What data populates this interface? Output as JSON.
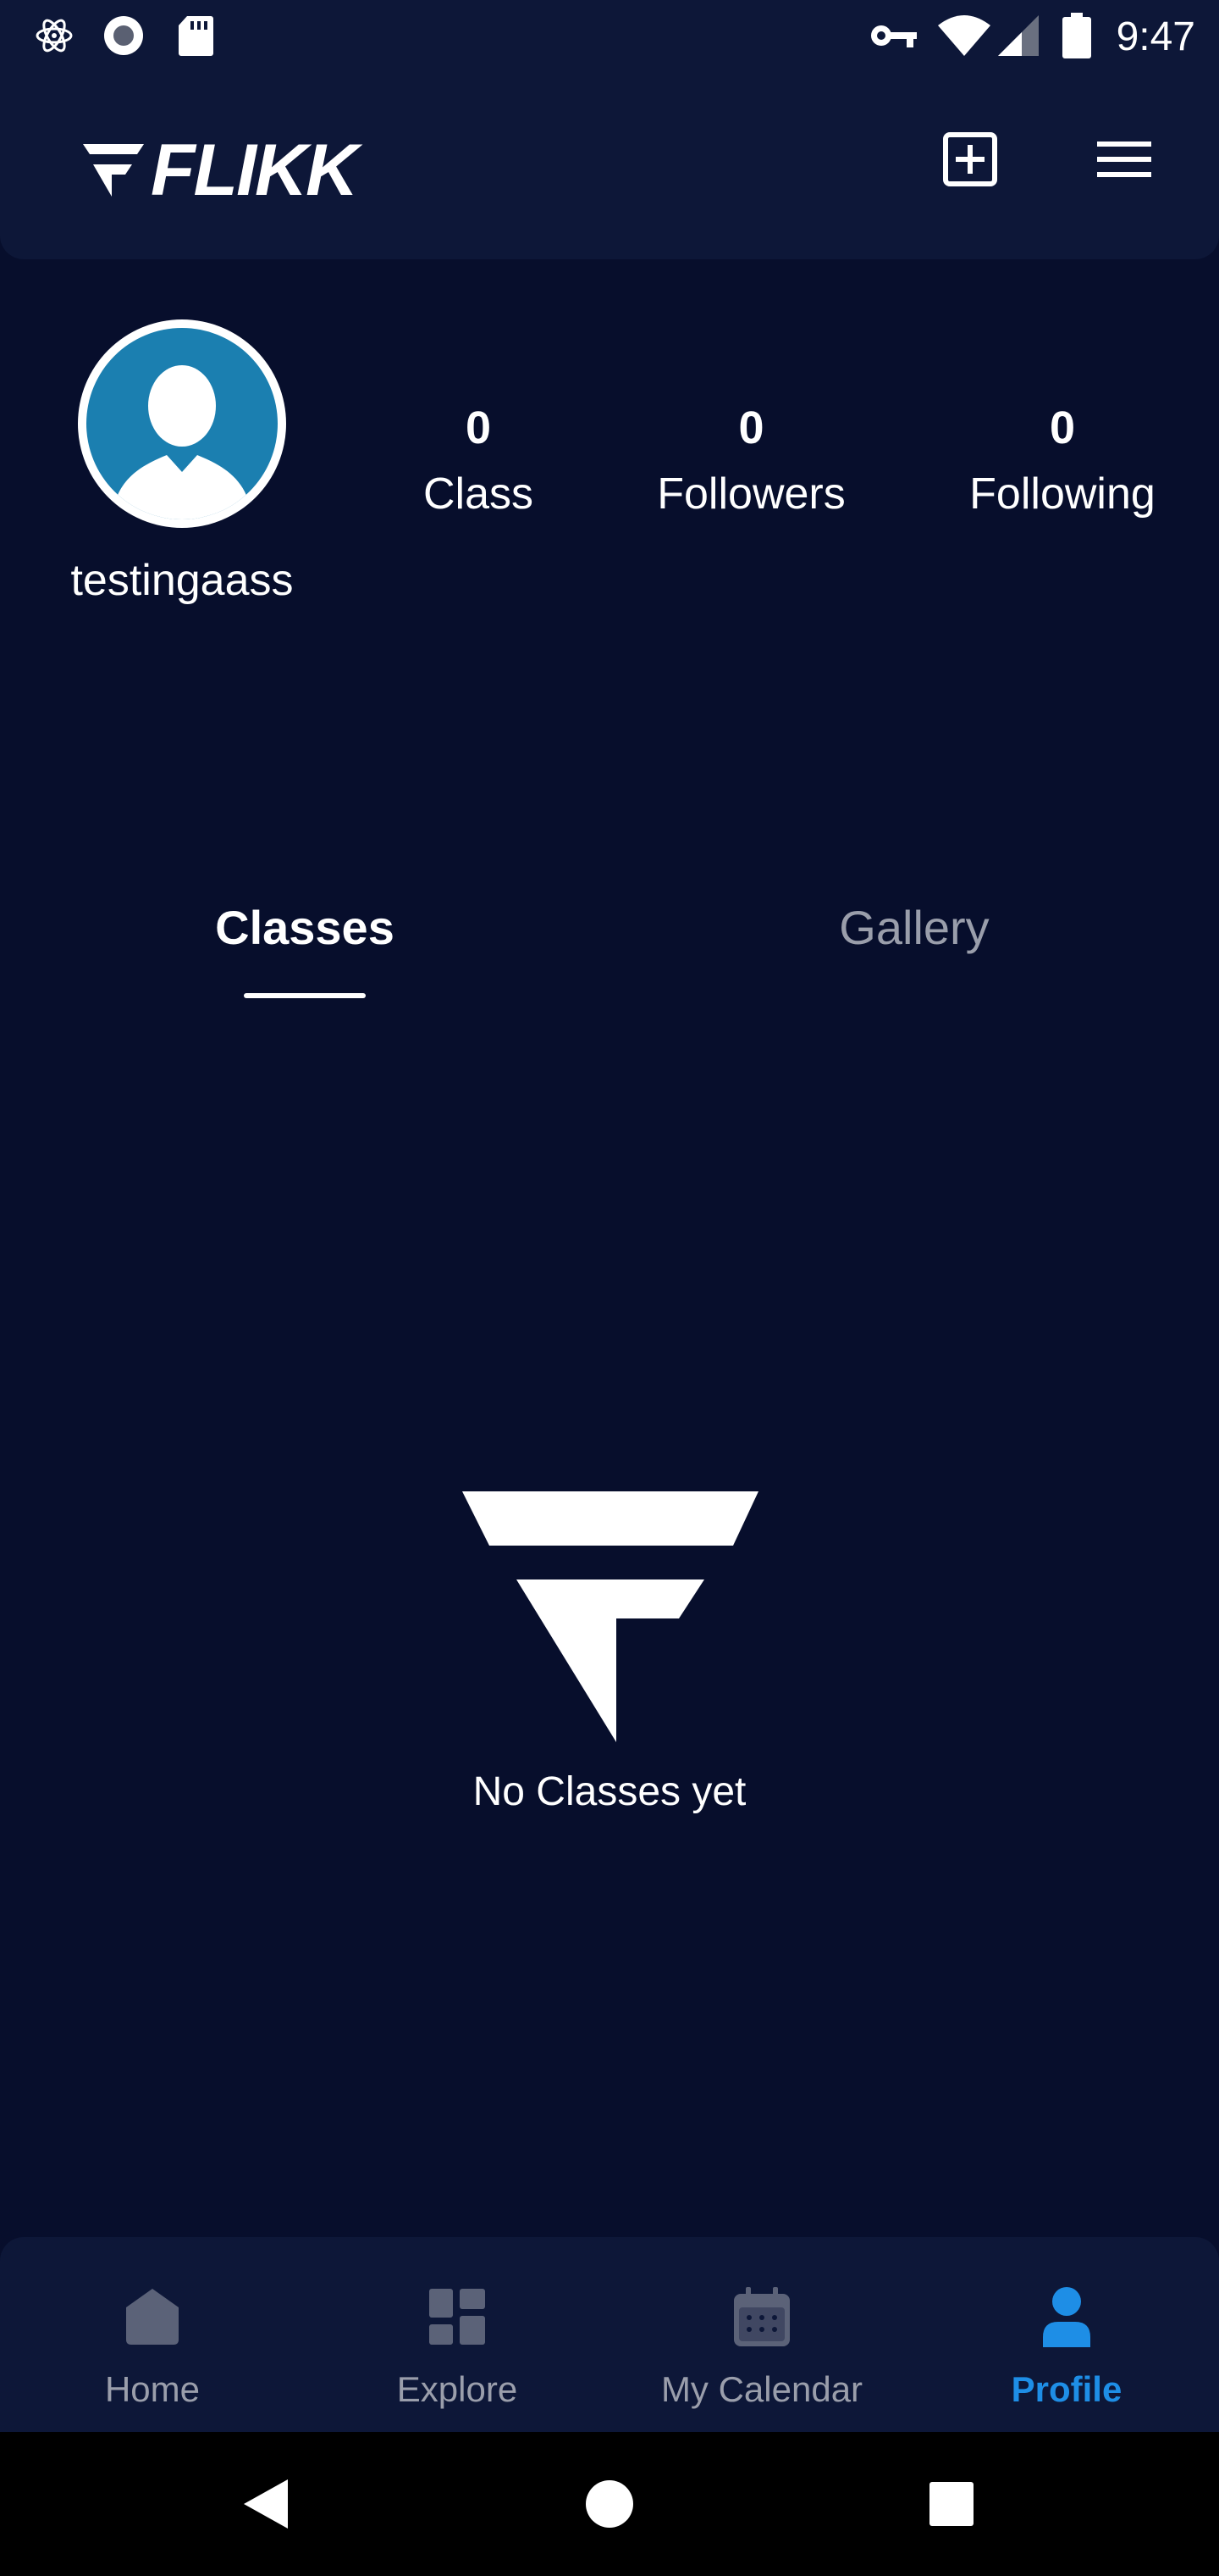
{
  "status_bar": {
    "time": "9:47",
    "left_icons": [
      "atom-icon",
      "record-icon",
      "sd-card-icon"
    ],
    "right_icons": [
      "vpn-key-icon",
      "wifi-icon",
      "signal-icon",
      "battery-icon"
    ]
  },
  "app_bar": {
    "logo_text": "FLIKK",
    "add_icon": "add-box-icon",
    "menu_icon": "menu-icon"
  },
  "profile": {
    "username": "testingaass",
    "stats": [
      {
        "value": "0",
        "label": "Class"
      },
      {
        "value": "0",
        "label": "Followers"
      },
      {
        "value": "0",
        "label": "Following"
      }
    ]
  },
  "tabs": [
    {
      "label": "Classes",
      "active": true
    },
    {
      "label": "Gallery",
      "active": false
    }
  ],
  "empty_state": {
    "message": "No Classes yet"
  },
  "bottom_nav": [
    {
      "label": "Home",
      "icon": "home-icon",
      "active": false
    },
    {
      "label": "Explore",
      "icon": "explore-grid-icon",
      "active": false
    },
    {
      "label": "My Calendar",
      "icon": "calendar-icon",
      "active": false
    },
    {
      "label": "Profile",
      "icon": "profile-icon",
      "active": true
    }
  ],
  "colors": {
    "background": "#070e2c",
    "bar": "#0d1738",
    "accent": "#1e8ee6",
    "avatar": "#1b7fb0",
    "inactive": "#9a9eab"
  }
}
